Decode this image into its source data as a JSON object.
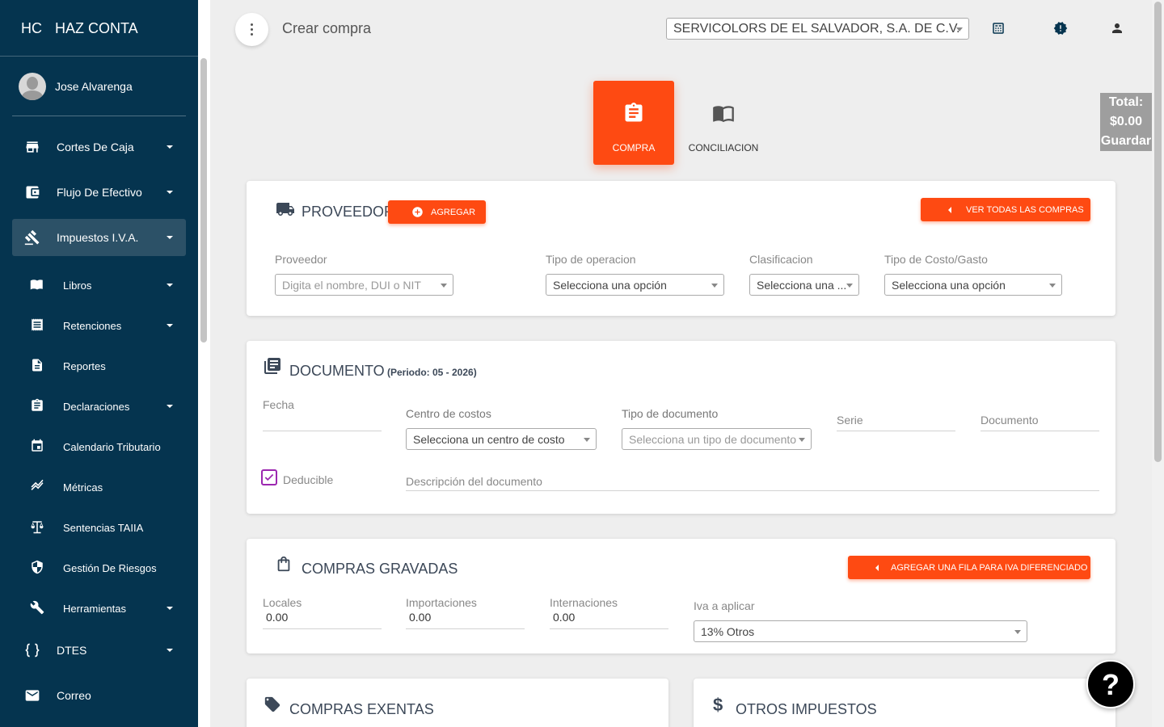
{
  "brand": {
    "mini": "HC",
    "full": "HAZ CONTA"
  },
  "user": {
    "name": "Jose Alvarenga"
  },
  "sidebar": {
    "items": [
      {
        "label": "Cortes De Caja",
        "icon": "store-icon",
        "has_caret": true
      },
      {
        "label": "Flujo De Efectivo",
        "icon": "wallet-icon",
        "has_caret": true
      },
      {
        "label": "Impuestos I.V.A.",
        "icon": "gavel-icon",
        "has_caret": true,
        "active": true
      }
    ],
    "sub_items": [
      {
        "label": "Libros",
        "icon": "book-icon",
        "has_caret": true
      },
      {
        "label": "Retenciones",
        "icon": "receipt-icon",
        "has_caret": true
      },
      {
        "label": "Reportes",
        "icon": "document-icon",
        "has_caret": false
      },
      {
        "label": "Declaraciones",
        "icon": "clipboard-icon",
        "has_caret": true
      },
      {
        "label": "Calendario Tributario",
        "icon": "calendar-icon",
        "has_caret": false
      },
      {
        "label": "Métricas",
        "icon": "trending-icon",
        "has_caret": false
      },
      {
        "label": "Sentencias TAIIA",
        "icon": "scale-icon",
        "has_caret": false
      },
      {
        "label": "Gestión De Riesgos",
        "icon": "shield-icon",
        "has_caret": false
      },
      {
        "label": "Herramientas",
        "icon": "wrench-icon",
        "has_caret": true
      }
    ],
    "bottom_items": [
      {
        "label": "DTES",
        "icon": "braces-icon",
        "has_caret": true
      },
      {
        "label": "Correo",
        "icon": "mail-icon",
        "has_caret": false
      }
    ]
  },
  "topbar": {
    "title": "Crear compra",
    "company": "SERVICOLORS DE EL SALVADOR, S.A. DE C.V."
  },
  "tabs": {
    "compra": "COMPRA",
    "conciliacion": "CONCILIACION"
  },
  "total": {
    "label": "Total:",
    "amount": "$0.00",
    "save": "Guardar"
  },
  "proveedor": {
    "title": "PROVEEDOR",
    "add_button": "AGREGAR",
    "view_all_button": "VER TODAS LAS COMPRAS",
    "fields": {
      "proveedor_label": "Proveedor",
      "proveedor_placeholder": "Digita el nombre, DUI o NIT",
      "tipo_operacion_label": "Tipo de operacion",
      "tipo_operacion_value": "Selecciona una opción",
      "clasificacion_label": "Clasificacion",
      "clasificacion_value": "Selecciona una ...",
      "tipo_costo_label": "Tipo de Costo/Gasto",
      "tipo_costo_value": "Selecciona una opción"
    }
  },
  "documento": {
    "title": "DOCUMENTO",
    "periodo": "(Periodo: 05 - 2026)",
    "fecha_label": "Fecha",
    "centro_costos_label": "Centro de costos",
    "centro_costos_value": "Selecciona un centro de costo",
    "tipo_documento_label": "Tipo de documento",
    "tipo_documento_placeholder": "Selecciona un tipo de documento",
    "serie_label": "Serie",
    "documento_label": "Documento",
    "deducible_label": "Deducible",
    "deducible_checked": true,
    "descripcion_label": "Descripción del documento"
  },
  "gravadas": {
    "title": "COMPRAS GRAVADAS",
    "add_row_button": "AGREGAR UNA FILA PARA IVA DIFERENCIADO",
    "locales_label": "Locales",
    "locales_value": "0.00",
    "importaciones_label": "Importaciones",
    "importaciones_value": "0.00",
    "internaciones_label": "Internaciones",
    "internaciones_value": "0.00",
    "iva_label": "Iva a aplicar",
    "iva_value": "13% Otros"
  },
  "exentas": {
    "title": "COMPRAS EXENTAS"
  },
  "otros": {
    "title": "OTROS IMPUESTOS"
  },
  "help": {
    "label": "?"
  },
  "colors": {
    "sidebar": "#05344f",
    "accent": "#fe4a12",
    "checkbox": "#9c27b0"
  }
}
